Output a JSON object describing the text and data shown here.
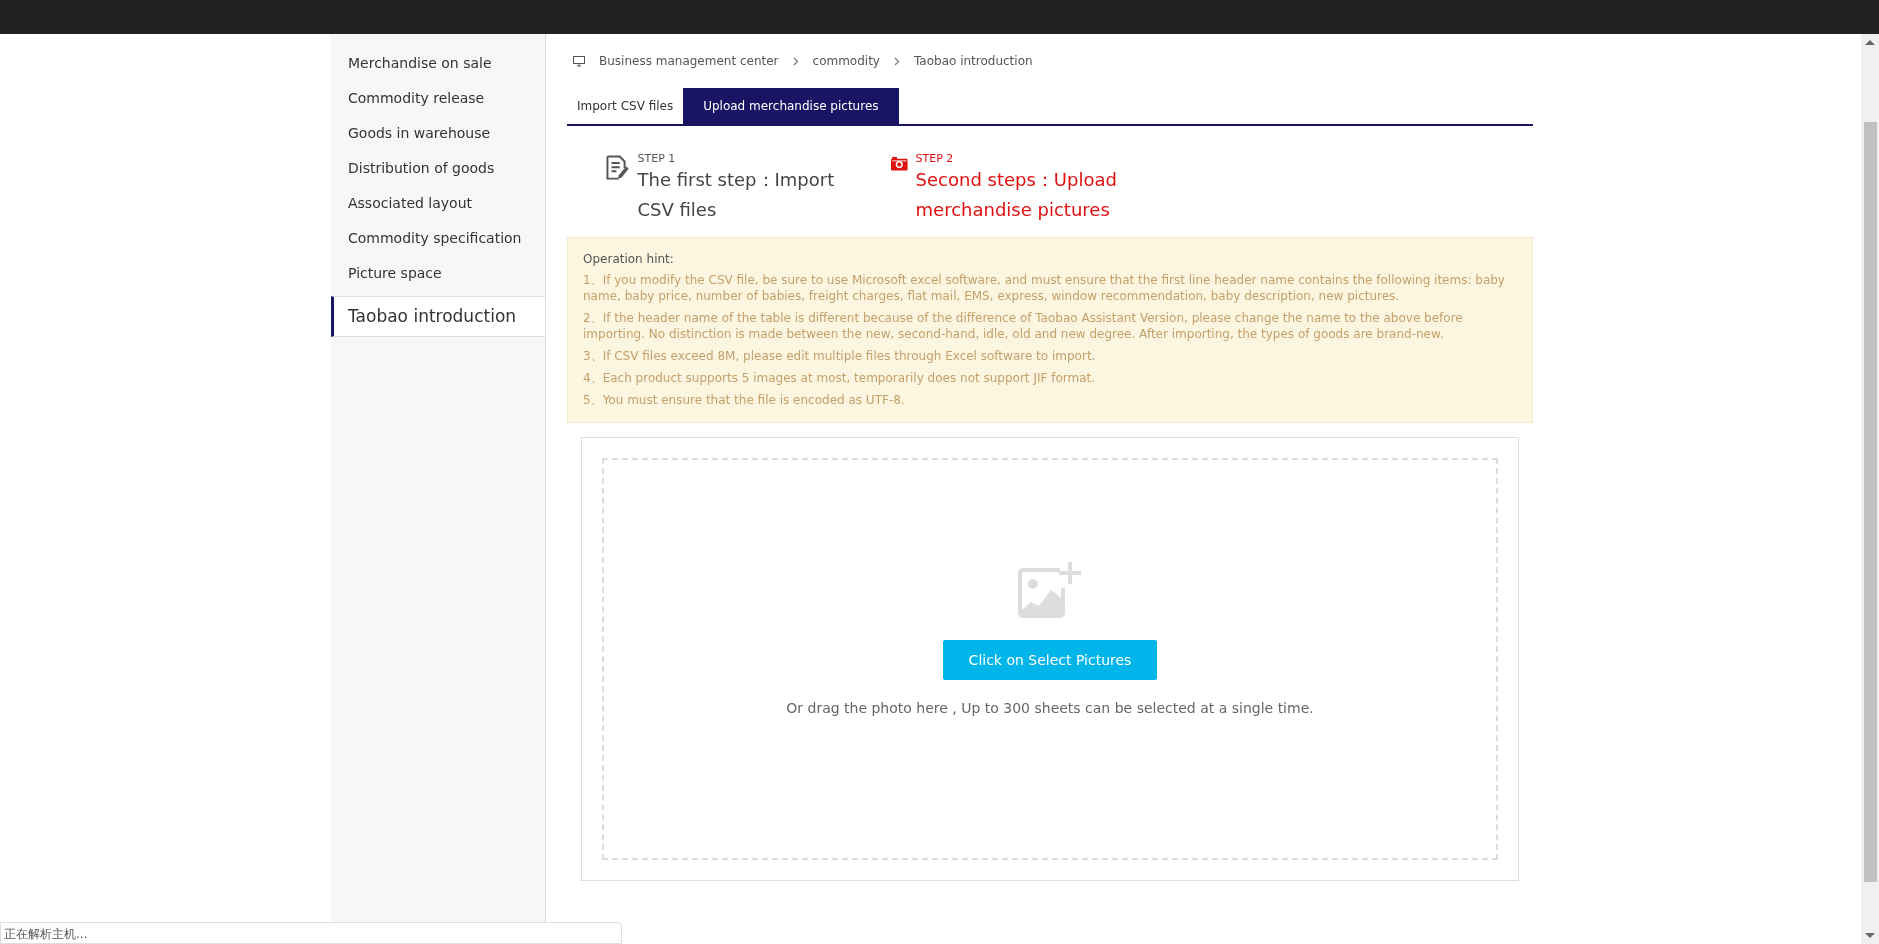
{
  "sidebar": {
    "items": [
      {
        "label": "Merchandise on sale",
        "selected": false
      },
      {
        "label": "Commodity release",
        "selected": false
      },
      {
        "label": "Goods in warehouse",
        "selected": false
      },
      {
        "label": "Distribution of goods",
        "selected": false
      },
      {
        "label": "Associated layout",
        "selected": false
      },
      {
        "label": "Commodity specification",
        "selected": false
      },
      {
        "label": "Picture space",
        "selected": false
      },
      {
        "label": "Taobao introduction",
        "selected": true
      }
    ]
  },
  "breadcrumb": [
    "Business management center",
    "commodity",
    "Taobao introduction"
  ],
  "tabs": [
    {
      "label": "Import CSV files",
      "selected": false
    },
    {
      "label": "Upload merchandise pictures",
      "selected": true
    }
  ],
  "steps": [
    {
      "kind": "document",
      "step": "STEP 1",
      "title": "The first step：Import CSV files",
      "current": false
    },
    {
      "kind": "camera",
      "step": "STEP 2",
      "title": "Second steps：Upload merchandise pictures",
      "current": true
    }
  ],
  "hint": {
    "title": "Operation hint:",
    "items": [
      "1、If you modify the CSV file, be sure to use Microsoft excel software, and must ensure that the first line header name contains the following items: baby name, baby price, number of babies, freight charges, flat mail, EMS, express, window recommendation, baby description, new pictures.",
      "2、If the header name of the table is different because of the difference of Taobao Assistant Version, please change the name to the above before importing. No distinction is made between the new, second-hand, idle, old and new degree. After importing, the types of goods are brand-new.",
      "3、If CSV files exceed 8M, please edit multiple files through Excel software to import.",
      "4、Each product supports 5 images at most, temporarily does not support JIF format.",
      "5、You must ensure that the file is encoded as UTF-8."
    ]
  },
  "upload": {
    "button": "Click on Select Pictures",
    "note": "Or drag the photo here , Up to 300 sheets can be selected at a single time."
  },
  "status_bar": "正在解析主机..."
}
